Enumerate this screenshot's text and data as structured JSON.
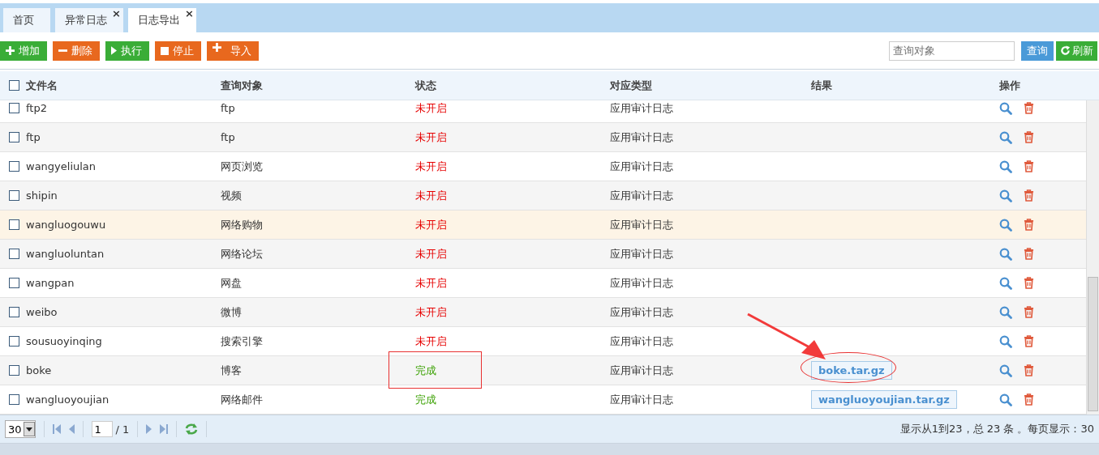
{
  "tabs": [
    {
      "label": "首页",
      "selected": false,
      "closable": false
    },
    {
      "label": "异常日志",
      "selected": false,
      "closable": true
    },
    {
      "label": "日志导出",
      "selected": true,
      "closable": true
    }
  ],
  "close_glyph": "×",
  "toolbar": [
    {
      "label": "增加",
      "kind": "add",
      "color": "#3aad37"
    },
    {
      "label": "删除",
      "kind": "remove",
      "color": "#e8681e"
    },
    {
      "label": "执行",
      "kind": "run",
      "color": "#3aad37"
    },
    {
      "label": "停止",
      "kind": "stop",
      "color": "#e8681e"
    },
    {
      "label": "导入",
      "kind": "import",
      "color": "#e8681e"
    }
  ],
  "search": {
    "placeholder": "查询对象",
    "button": "查询",
    "refresh": "刷新"
  },
  "table": {
    "all_checked": false,
    "columns": [
      "文件名",
      "查询对象",
      "状态",
      "对应类型",
      "结果",
      "操作"
    ],
    "rows": [
      {
        "name": "ftp2",
        "target": "ftp",
        "status": "未开启",
        "kind": "off",
        "type": "应用审计日志",
        "checked": false,
        "highlighted": false
      },
      {
        "name": "ftp",
        "target": "ftp",
        "status": "未开启",
        "kind": "off",
        "type": "应用审计日志",
        "checked": false,
        "highlighted": false
      },
      {
        "name": "wangyeliulan",
        "target": "网页浏览",
        "status": "未开启",
        "kind": "off",
        "type": "应用审计日志",
        "checked": false,
        "highlighted": false
      },
      {
        "name": "shipin",
        "target": "视频",
        "status": "未开启",
        "kind": "off",
        "type": "应用审计日志",
        "checked": false,
        "highlighted": false
      },
      {
        "name": "wangluogouwu",
        "target": "网络购物",
        "status": "未开启",
        "kind": "off",
        "type": "应用审计日志",
        "checked": false,
        "highlighted": true
      },
      {
        "name": "wangluoluntan",
        "target": "网络论坛",
        "status": "未开启",
        "kind": "off",
        "type": "应用审计日志",
        "checked": false,
        "highlighted": false
      },
      {
        "name": "wangpan",
        "target": "网盘",
        "status": "未开启",
        "kind": "off",
        "type": "应用审计日志",
        "checked": false,
        "highlighted": false
      },
      {
        "name": "weibo",
        "target": "微博",
        "status": "未开启",
        "kind": "off",
        "type": "应用审计日志",
        "checked": false,
        "highlighted": false
      },
      {
        "name": "sousuoyinqing",
        "target": "搜索引擎",
        "status": "未开启",
        "kind": "off",
        "type": "应用审计日志",
        "checked": false,
        "highlighted": false
      },
      {
        "name": "boke",
        "target": "博客",
        "status": "完成",
        "kind": "done",
        "type": "应用审计日志",
        "result": "boke.tar.gz",
        "checked": false,
        "highlighted": false
      },
      {
        "name": "wangluoyoujian",
        "target": "网络邮件",
        "status": "完成",
        "kind": "done",
        "type": "应用审计日志",
        "result": "wangluoyoujian.tar.gz",
        "checked": false,
        "highlighted": false
      }
    ]
  },
  "pager": {
    "page_size": "30",
    "page": "1",
    "total_pages": "/ 1",
    "summary": "显示从1到23，总 23 条 。每页显示：30"
  }
}
